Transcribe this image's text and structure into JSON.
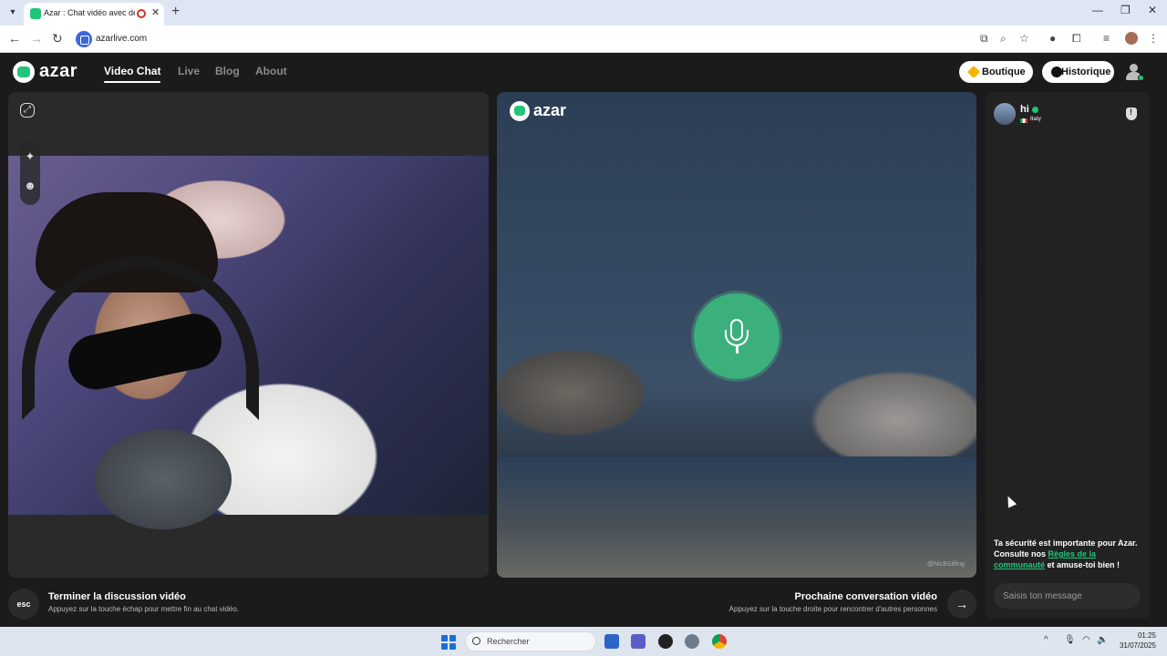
{
  "browser": {
    "tab_title": "Azar : Chat vidéo avec de n",
    "url": "azarlive.com",
    "colors": {
      "tabbar": "#dfe6f3",
      "favicon": "#22c47a"
    }
  },
  "site": {
    "logo_text": "azar",
    "nav": [
      {
        "label": "Video Chat",
        "active": true
      },
      {
        "label": "Live"
      },
      {
        "label": "Blog"
      },
      {
        "label": "About"
      }
    ],
    "boutique_label": "Boutique",
    "historique_label": "Historique",
    "accent_color": "#22c47a"
  },
  "video": {
    "remote_logo_text": "azar",
    "watermark": "@NicBSilfing"
  },
  "sidebar": {
    "peer_name": "hi",
    "peer_country": "Italy",
    "safety_prefix": "Ta sécurité est importante pour Azar. Consulte nos ",
    "safety_link": "Règles de la communauté",
    "safety_suffix": " et amuse-toi bien !",
    "message_placeholder": "Saisis ton message"
  },
  "controls": {
    "esc_label": "esc",
    "end_title": "Terminer la discussion vidéo",
    "end_sub": "Appuyez sur la touche échap pour mettre fin au chat vidéo.",
    "next_title": "Prochaine conversation vidéo",
    "next_sub": "Appuyez sur la touche droite pour rencontrer d'autres personnes",
    "next_icon": "arrow-right-icon"
  },
  "taskbar": {
    "search_label": "Rechercher",
    "time": "01:25",
    "date": "31/07/2025"
  }
}
